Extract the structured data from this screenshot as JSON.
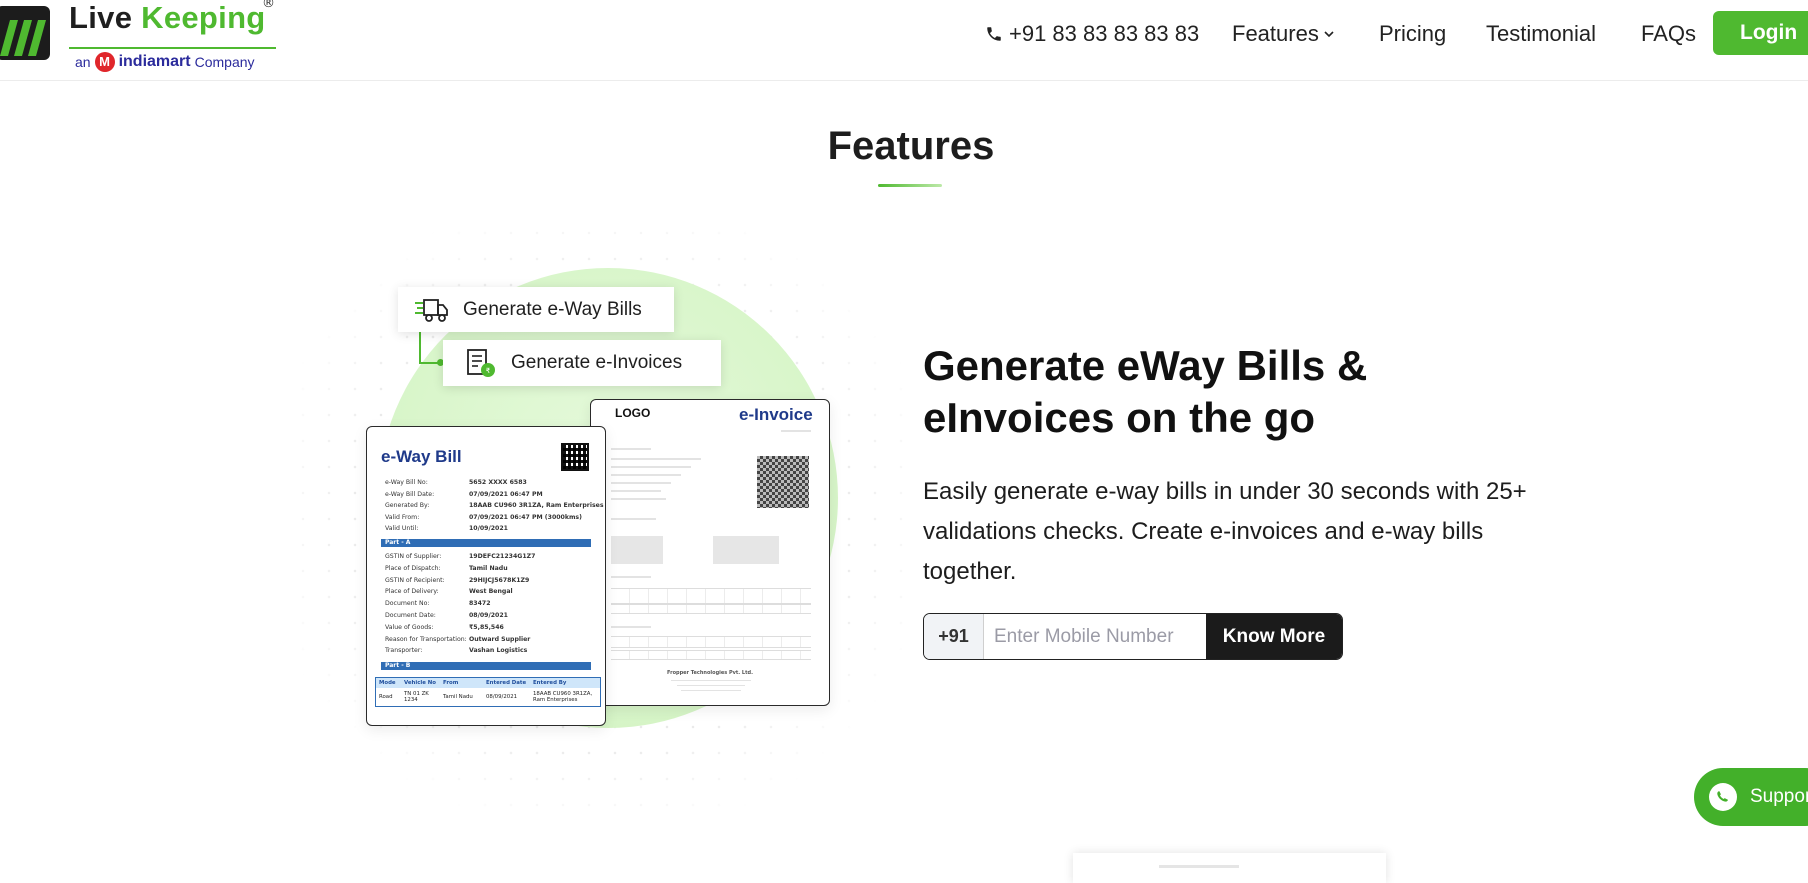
{
  "header": {
    "logo": {
      "word1": "Live",
      "word2": "Keeping",
      "registered": "®",
      "sub_prefix": "an",
      "sub_brand": "indiamart",
      "sub_suffix": "Company"
    },
    "phone": "+91 83 83 83 83 83",
    "nav": {
      "features": "Features",
      "pricing": "Pricing",
      "testimonial": "Testimonial",
      "faqs": "FAQs"
    },
    "login": "Login"
  },
  "section": {
    "title": "Features"
  },
  "illustration": {
    "tags": {
      "eway": "Generate e-Way Bills",
      "einvoice": "Generate e-Invoices"
    },
    "eway_bill": {
      "title": "e-Way Bill",
      "fields": [
        {
          "k": "e-Way Bill No:",
          "v": "5652 XXXX 6583"
        },
        {
          "k": "e-Way Bill Date:",
          "v": "07/09/2021 06:47 PM"
        },
        {
          "k": "Generated By:",
          "v": "18AAB CU960 3R1ZA, Ram Enterprises"
        },
        {
          "k": "Valid From:",
          "v": "07/09/2021 06:47 PM (3000kms)"
        },
        {
          "k": "Valid Until:",
          "v": "10/09/2021"
        }
      ],
      "part_a": "Part - A",
      "fields_a": [
        {
          "k": "GSTIN of Supplier:",
          "v": "19DEFC21234G1Z7"
        },
        {
          "k": "Place of Dispatch:",
          "v": "Tamil Nadu"
        },
        {
          "k": "GSTIN of Recipient:",
          "v": "29HIJCJ5678K1Z9"
        },
        {
          "k": "Place of Delivery:",
          "v": "West Bengal"
        },
        {
          "k": "Document No:",
          "v": "83472"
        },
        {
          "k": "Document Date:",
          "v": "08/09/2021"
        },
        {
          "k": "Value of Goods:",
          "v": "₹5,85,546"
        },
        {
          "k": "Reason for Transportation:",
          "v": "Outward Supplier"
        },
        {
          "k": "Transporter:",
          "v": "Vashan Logistics"
        }
      ],
      "part_b": "Part - B",
      "table_head": [
        "Mode",
        "Vehicle No",
        "From",
        "Entered Date",
        "Entered By"
      ],
      "table_row": [
        "Road",
        "TN 01 ZK 1234",
        "Tamil Nadu",
        "08/09/2021",
        "18AAB CU960 3R1ZA, Ram Enterprises"
      ]
    },
    "einvoice": {
      "logo": "LOGO",
      "title": "e-Invoice",
      "footer": "Fropper Technologies Pvt. Ltd."
    }
  },
  "content": {
    "headline_line1": "Generate eWay Bills &",
    "headline_line2": "eInvoices on the go",
    "description": "Easily generate e-way bills in under 30 seconds with 25+ validations checks. Create e-invoices and e-way bills together.",
    "country_code": "+91",
    "mobile_placeholder": "Enter Mobile Number",
    "cta": "Know More"
  },
  "support": {
    "label": "Support"
  },
  "colors": {
    "brand_green": "#4fb930",
    "dark": "#1b1b1b",
    "doc_blue": "#1f3a8a"
  }
}
